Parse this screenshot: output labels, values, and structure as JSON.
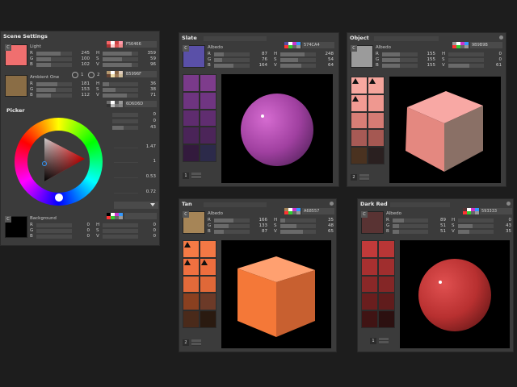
{
  "scene": {
    "title": "Scene Settings",
    "light": {
      "label": "Light",
      "hex": "F56466",
      "color": "#f06f6f",
      "r": "245",
      "g": "100",
      "b": "102",
      "h": "359",
      "s": "59",
      "v": "96",
      "btn": "C"
    },
    "ambient": {
      "label": "Ambient One",
      "hex": "B5996F",
      "color": "#8a6d45",
      "r": "181",
      "g": "153",
      "b": "112",
      "h": "36",
      "s": "38",
      "v": "71",
      "radio1": "1",
      "radio2": "2"
    },
    "picker": {
      "title": "Picker",
      "hex": "6D6D6D",
      "v1": "0",
      "v2": "0",
      "v3": "43",
      "v4": "1.47",
      "v5": "1",
      "v6": "0.53",
      "v7": "0.72"
    },
    "background": {
      "label": "Background",
      "color": "#000000",
      "r": "0",
      "g": "0",
      "b": "0",
      "h": "0",
      "s": "0",
      "v": "0",
      "btn": "C"
    }
  },
  "panels": {
    "slate": {
      "title": "Slate",
      "albedo": "Albedo",
      "hex": "574CA4",
      "swatch": "#5a50a8",
      "r": "87",
      "g": "76",
      "b": "164",
      "h": "248",
      "s": "54",
      "v": "64",
      "count": "1",
      "palette": [
        "#7a3a8a",
        "#7e3c8c",
        "#6e3480",
        "#703582",
        "#5e2c6e",
        "#602d70",
        "#4a2458",
        "#4c2559",
        "#331a3d",
        "#2c2a4a"
      ]
    },
    "object": {
      "title": "Object",
      "albedo": "Albedo",
      "hex": "9B9B9B",
      "swatch": "#9b9b9b",
      "r": "155",
      "g": "155",
      "b": "155",
      "h": "0",
      "s": "0",
      "v": "61",
      "count": "2",
      "palette": [
        "#f7a8a0",
        "#f4a59c",
        "#f19b93",
        "#ef9890",
        "#d87e76",
        "#d57b74",
        "#a75a55",
        "#a55852",
        "#4a3220",
        "#2a2020"
      ]
    },
    "tan": {
      "title": "Tan",
      "albedo": "Albedo",
      "hex": "A68557",
      "swatch": "#a68557",
      "r": "166",
      "g": "133",
      "b": "87",
      "h": "35",
      "s": "48",
      "v": "65",
      "count": "2",
      "palette": [
        "#f57a45",
        "#f37845",
        "#f07040",
        "#ee6e3e",
        "#e36a3a",
        "#e06838",
        "#8a4020",
        "#6c3a28",
        "#4a2a1a",
        "#2a1a10"
      ]
    },
    "darkred": {
      "title": "Dark Red",
      "albedo": "Albedo",
      "hex": "593333",
      "swatch": "#593333",
      "r": "89",
      "g": "51",
      "b": "51",
      "h": "0",
      "s": "43",
      "v": "35",
      "count": "1",
      "palette": [
        "#c23a3a",
        "#b83636",
        "#a83030",
        "#a02e2e",
        "#8a2828",
        "#842626",
        "#6a1e1e",
        "#601c1c",
        "#401414",
        "#2c1010"
      ]
    }
  },
  "labels": {
    "r": "R",
    "g": "G",
    "b": "B",
    "h": "H",
    "s": "S",
    "v": "V"
  }
}
